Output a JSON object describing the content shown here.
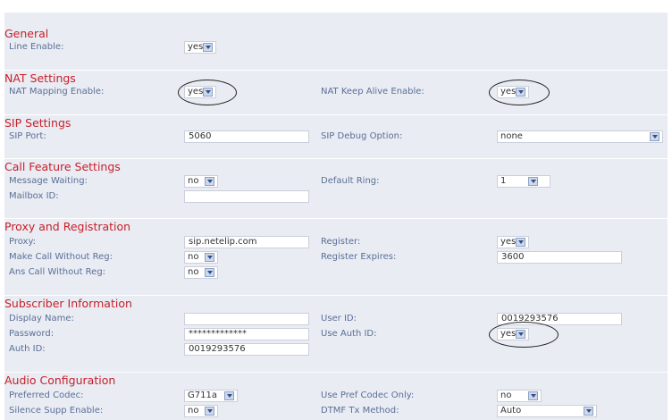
{
  "sections": [
    {
      "title": "General",
      "rows": [
        {
          "label": "Line Enable:",
          "value": "yes",
          "kind": "select"
        }
      ]
    },
    {
      "title": "NAT Settings",
      "rows": [
        {
          "label": "NAT Mapping Enable:",
          "value": "yes",
          "kind": "select",
          "circled": true
        },
        {
          "label": "NAT Keep Alive Enable:",
          "value": "yes",
          "kind": "select",
          "circled": true
        }
      ]
    },
    {
      "title": "SIP Settings",
      "rows": [
        {
          "label": "SIP Port:",
          "value": "5060",
          "kind": "input"
        },
        {
          "label": "SIP Debug Option:",
          "value": "none",
          "kind": "select"
        }
      ]
    },
    {
      "title": "Call Feature Settings",
      "rows": [
        {
          "label": "Message Waiting:",
          "value": "no",
          "kind": "select"
        },
        {
          "label": "Default Ring:",
          "value": "1",
          "kind": "select"
        },
        {
          "label": "Mailbox ID:",
          "value": "",
          "kind": "input"
        }
      ]
    },
    {
      "title": "Proxy and Registration",
      "rows": [
        {
          "label": "Proxy:",
          "value": "sip.netelip.com",
          "kind": "input"
        },
        {
          "label": "Register:",
          "value": "yes",
          "kind": "select"
        },
        {
          "label": "Make Call Without Reg:",
          "value": "no",
          "kind": "select"
        },
        {
          "label": "Register Expires:",
          "value": "3600",
          "kind": "input"
        },
        {
          "label": "Ans Call Without Reg:",
          "value": "no",
          "kind": "select"
        }
      ]
    },
    {
      "title": "Subscriber Information",
      "rows": [
        {
          "label": "Display Name:",
          "value": "",
          "kind": "input"
        },
        {
          "label": "User ID:",
          "value": "0019293576",
          "kind": "input"
        },
        {
          "label": "Password:",
          "value": "*************",
          "kind": "password"
        },
        {
          "label": "Use Auth ID:",
          "value": "yes",
          "kind": "select",
          "circled": true
        },
        {
          "label": "Auth ID:",
          "value": "0019293576",
          "kind": "input"
        }
      ]
    },
    {
      "title": "Audio Configuration",
      "rows": [
        {
          "label": "Preferred Codec:",
          "value": "G711a",
          "kind": "select"
        },
        {
          "label": "Use Pref Codec Only:",
          "value": "no",
          "kind": "select"
        },
        {
          "label": "Silence Supp Enable:",
          "value": "no",
          "kind": "select"
        },
        {
          "label": "DTMF Tx Method:",
          "value": "Auto",
          "kind": "select"
        }
      ]
    }
  ],
  "colors": {
    "section_title": "#c8202a",
    "label": "#5a6f97",
    "panel_background": "#e9ecf3",
    "highlight_oval": "#222222"
  }
}
